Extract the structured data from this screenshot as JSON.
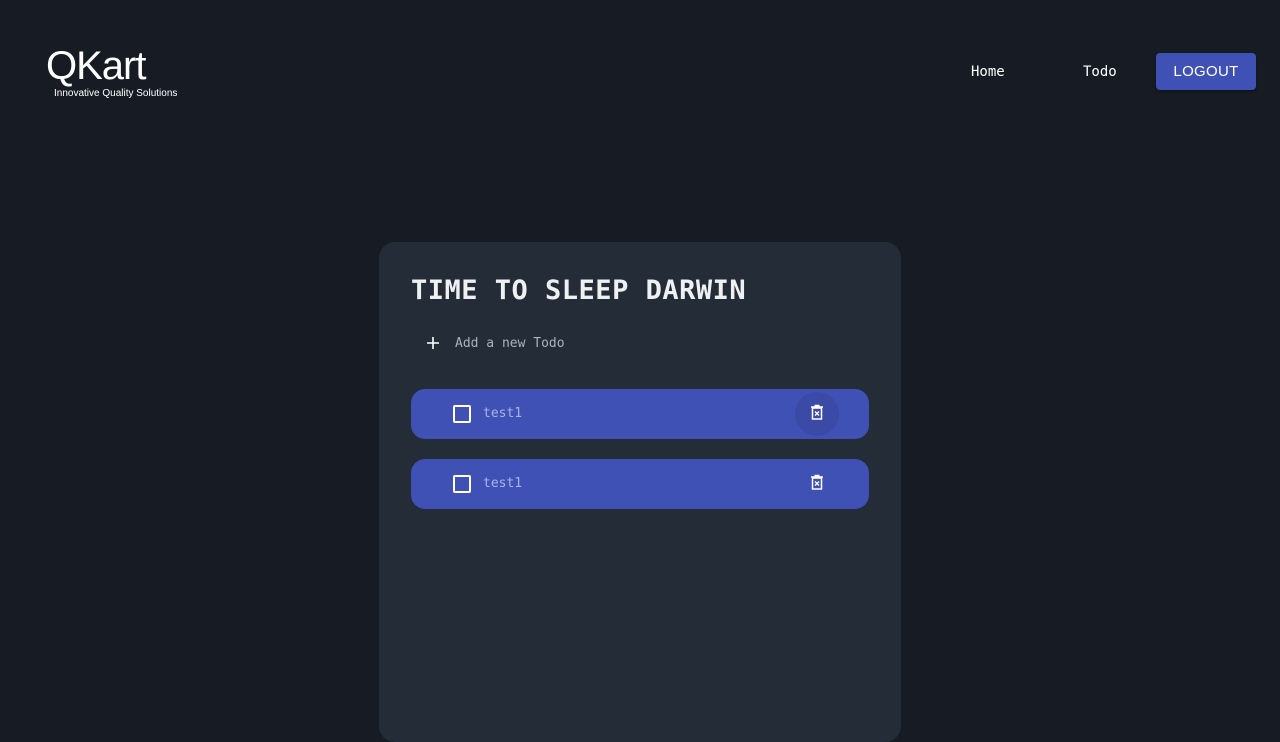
{
  "header": {
    "logo": {
      "name": "QKart",
      "tagline": "Innovative Quality Solutions"
    },
    "nav": [
      {
        "label": "Home"
      },
      {
        "label": "Todo"
      }
    ],
    "logout_label": "LOGOUT"
  },
  "card": {
    "title": "TIME TO SLEEP DARWIN",
    "add_todo_label": "Add a new Todo",
    "todos": [
      {
        "text": "test1",
        "checked": false
      },
      {
        "text": "test1",
        "checked": false
      }
    ]
  },
  "colors": {
    "background": "#171c24",
    "card": "#232c37",
    "accent": "#3f51b5",
    "todo_text": "#a9b3e6"
  },
  "icons": [
    "plus-icon",
    "delete-icon"
  ]
}
